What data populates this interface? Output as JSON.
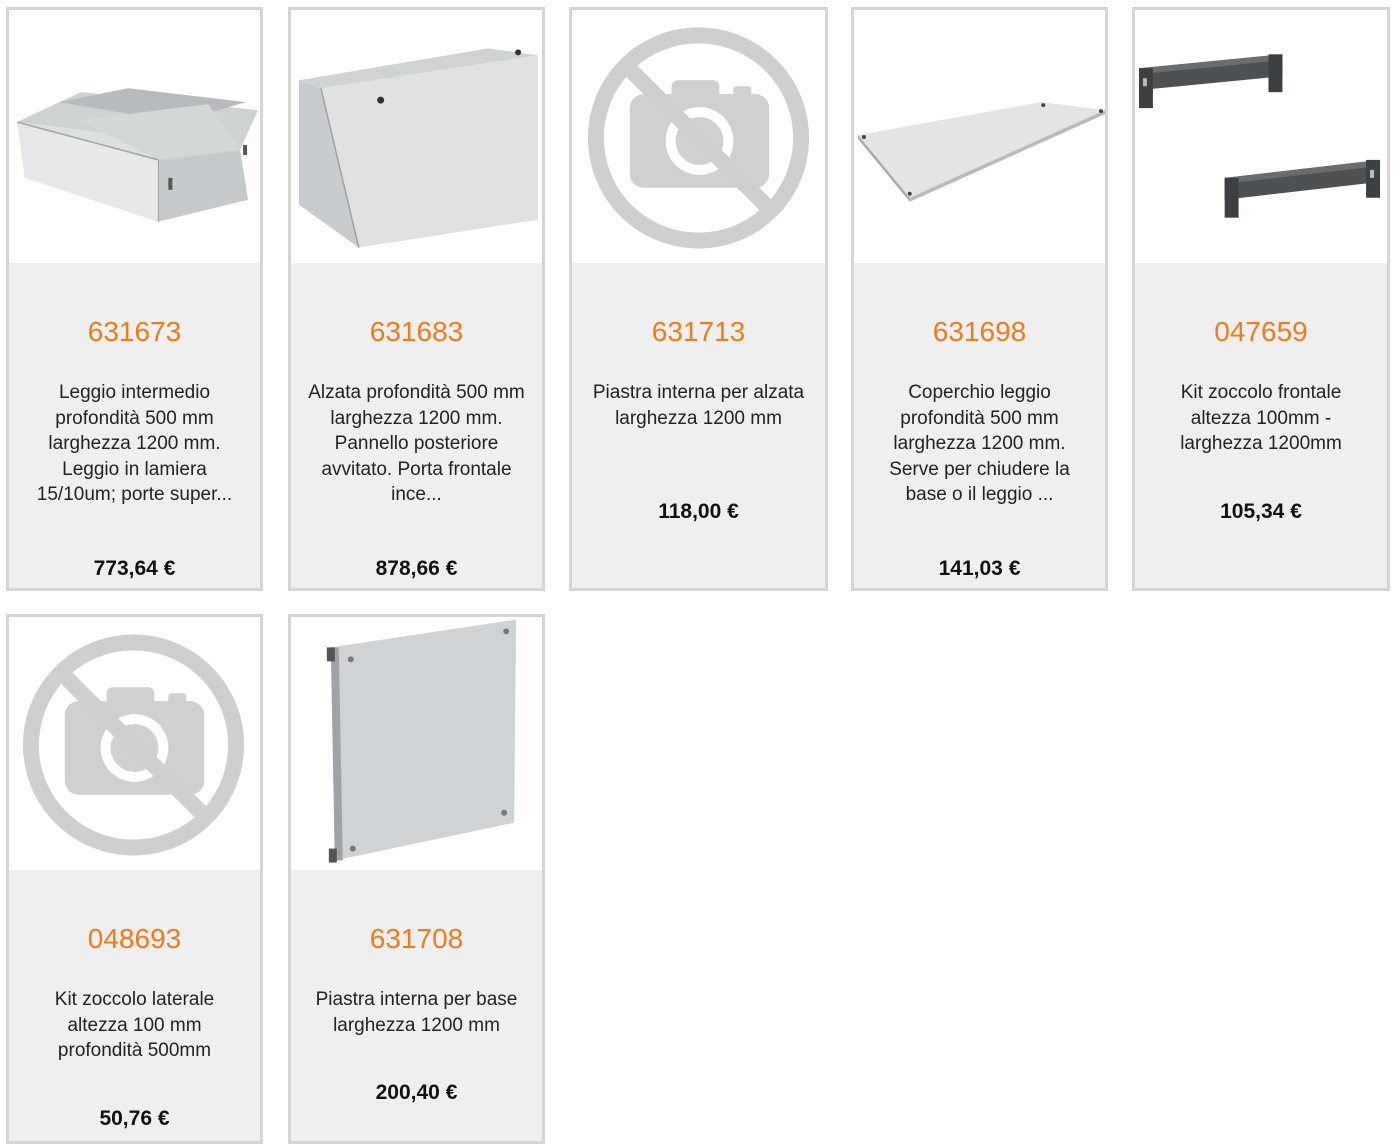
{
  "currency_symbol": "€",
  "products": [
    {
      "code": "631673",
      "image_icon": "console-desk-icon",
      "description": "Leggio intermedio profondità 500 mm larghezza 1200 mm. Leggio in lamiera 15/10um; porte super...",
      "price": "773,64 €"
    },
    {
      "code": "631683",
      "image_icon": "enclosure-riser-icon",
      "description": "Alzata profondità 500 mm larghezza 1200 mm. Pannello posteriore avvitato. Porta frontale ince...",
      "price": "878,66 €"
    },
    {
      "code": "631713",
      "image_icon": "no-image-icon",
      "description": "Piastra interna per alzata larghezza 1200 mm",
      "price": "118,00 €"
    },
    {
      "code": "631698",
      "image_icon": "cover-panel-icon",
      "description": "Coperchio leggio profondità 500 mm larghezza 1200 mm. Serve per chiudere la base o il leggio ...",
      "price": "141,03 €"
    },
    {
      "code": "047659",
      "image_icon": "plinth-kit-icon",
      "description": "Kit zoccolo frontale altezza 100mm - larghezza 1200mm",
      "price": "105,34 €"
    },
    {
      "code": "048693",
      "image_icon": "no-image-icon",
      "description": "Kit zoccolo laterale altezza 100 mm profondità 500mm",
      "price": "50,76 €"
    },
    {
      "code": "631708",
      "image_icon": "mounting-plate-icon",
      "description": "Piastra interna per base larghezza 1200 mm",
      "price": "200,40 €"
    }
  ],
  "colors": {
    "code": "#f07b1a",
    "card_bg": "#efefef",
    "card_border": "#d5d5d5"
  }
}
